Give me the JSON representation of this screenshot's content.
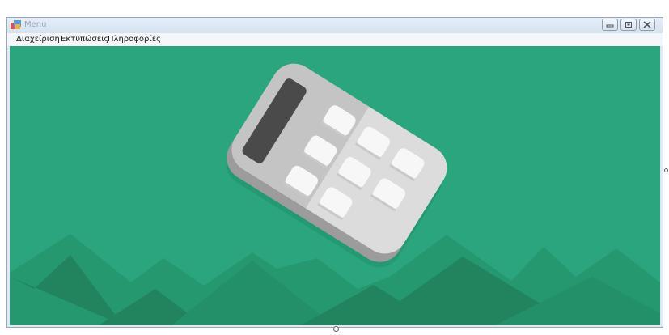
{
  "window": {
    "title": "Menu",
    "controls": {
      "minimize": "minimize-icon",
      "maximize": "maximize-icon",
      "close": "close-icon"
    }
  },
  "menu": {
    "items": [
      {
        "label": "Διαχείριση"
      },
      {
        "label": "Εκτυπώσεις"
      },
      {
        "label": "Πληροφορίες"
      }
    ]
  },
  "background": {
    "color": "#2aa57d",
    "mountain_color": "#238b68",
    "illustration": "calculator-icon"
  }
}
